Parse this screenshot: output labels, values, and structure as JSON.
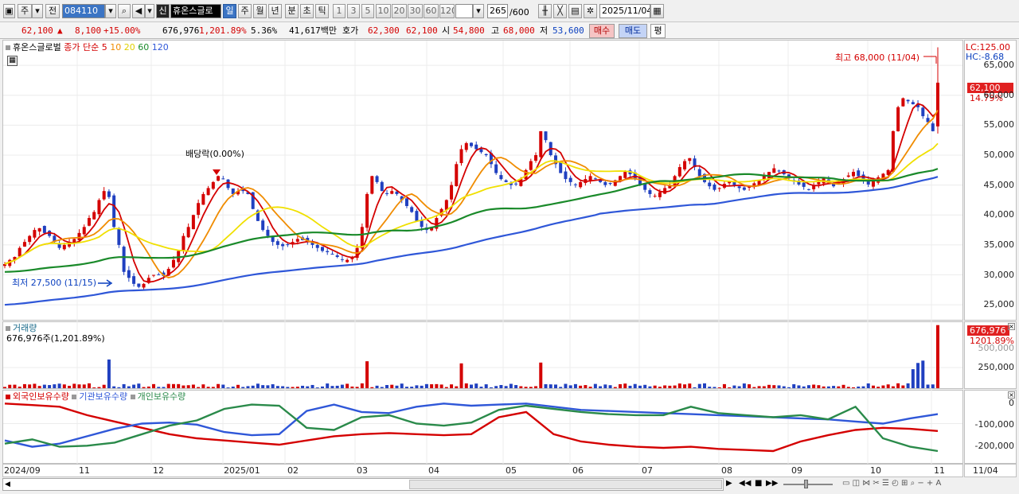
{
  "toolbar": {
    "type_label": "주",
    "prev_label": "전",
    "code": "084110",
    "signal_badge": "신",
    "stock_name": "휴온스글로",
    "periods": [
      "일",
      "주",
      "월",
      "년",
      "분",
      "초",
      "틱"
    ],
    "active_period": "일",
    "minute_nums": [
      "1",
      "3",
      "5",
      "10",
      "20",
      "30",
      "60",
      "120"
    ],
    "count": "265",
    "count_total": "/600",
    "date": "2025/11/04"
  },
  "quote": {
    "price": "62,100",
    "up_arrow": "▲",
    "change": "8,100",
    "change_pct": "+15.00%",
    "volume": "676,976",
    "volume_ratio": "1,201.89%",
    "turnover": "5.36%",
    "amount": "41,617백만",
    "ask_label": "호가",
    "ask": "62,300",
    "bid": "62,100",
    "open_label": "시",
    "open": "54,800",
    "high_label": "고",
    "high": "68,000",
    "low_label": "저",
    "low": "53,600",
    "buy_label": "매수",
    "sell_label": "매도",
    "eval_label": "평"
  },
  "price_panel": {
    "title": "휴온스글로벌",
    "ma_title": "종가 단순",
    "ma_periods": [
      "5",
      "10",
      "20",
      "60",
      "120"
    ],
    "ma_colors": [
      "#d40000",
      "#f08c00",
      "#f0e000",
      "#1a8a2a",
      "#2f57d8"
    ],
    "lc": "LC:125.00",
    "hc": "HC:-8.68",
    "high_note": "최고 68,000 (11/04)",
    "low_note": "최저 27,500 (11/15)",
    "dividend_note": "배당락(0.00%)",
    "last_price": "62,100",
    "last_pct": "14.79%",
    "y_ticks": [
      "65,000",
      "60,000",
      "55,000",
      "50,000",
      "45,000",
      "40,000",
      "35,000",
      "30,000",
      "25,000"
    ]
  },
  "volume_panel": {
    "title": "거래량",
    "summary": "676,976주(1,201.89%)",
    "last": "676,976",
    "last_pct": "1201.89%",
    "y_ticks": [
      "500,000",
      "250,000"
    ]
  },
  "holder_panel": {
    "series": [
      "외국인보유수량",
      "기관보유수량",
      "개인보유수량"
    ],
    "series_colors": [
      "#d40000",
      "#2f57d8",
      "#2a8a4a"
    ],
    "y_ticks": [
      "0",
      "-100,000",
      "-200,000"
    ]
  },
  "x_axis": {
    "labels": [
      "2024/09",
      "11",
      "12",
      "2025/01",
      "02",
      "03",
      "04",
      "05",
      "06",
      "07",
      "08",
      "09",
      "10",
      "11"
    ],
    "current": "11/04"
  },
  "chart_data": {
    "type": "candlestick",
    "ylim": [
      22500,
      69000
    ],
    "closes": [
      31800,
      32500,
      33000,
      34500,
      35500,
      36500,
      37500,
      37800,
      37000,
      36500,
      35500,
      34500,
      35000,
      35500,
      36000,
      37000,
      38000,
      39500,
      40500,
      42500,
      44000,
      43000,
      38000,
      35000,
      30500,
      29500,
      28500,
      28000,
      28500,
      29500,
      30000,
      30000,
      29800,
      31000,
      32500,
      34000,
      36500,
      38000,
      40000,
      42000,
      43500,
      44500,
      45500,
      46500,
      46000,
      44500,
      43500,
      44000,
      44000,
      43500,
      41000,
      39000,
      37500,
      36500,
      35500,
      35000,
      34800,
      35000,
      35500,
      36000,
      35800,
      35500,
      35000,
      34500,
      34000,
      33800,
      33500,
      33000,
      32500,
      32500,
      33000,
      34500,
      38000,
      43500,
      46500,
      45500,
      44000,
      43500,
      44000,
      43500,
      42500,
      41500,
      40500,
      39000,
      38000,
      37500,
      38000,
      39500,
      41000,
      42500,
      45000,
      48500,
      51000,
      52000,
      51500,
      51000,
      50500,
      50000,
      48500,
      47000,
      46000,
      45500,
      45000,
      45200,
      46000,
      47500,
      49000,
      50000,
      54000,
      52500,
      50000,
      48500,
      47000,
      46000,
      45500,
      45000,
      45500,
      46000,
      46500,
      46000,
      45500,
      45000,
      45200,
      45800,
      46500,
      47200,
      46800,
      46000,
      45000,
      44200,
      43500,
      43200,
      43800,
      44500,
      45000,
      46500,
      48000,
      49000,
      49500,
      48000,
      46500,
      45500,
      44800,
      44200,
      44500,
      45200,
      45600,
      45000,
      44500,
      44200,
      44800,
      45300,
      45800,
      46500,
      47200,
      47800,
      47400,
      46800,
      46200,
      45600,
      45100,
      44700,
      44300,
      44900,
      45500,
      46100,
      45400,
      44800,
      45400,
      46000,
      46600,
      47200,
      46500,
      45800,
      45100,
      45700,
      46300,
      46900,
      47500,
      54000,
      58000,
      59500,
      59000,
      58500,
      58000,
      56500,
      55500,
      54000,
      62100
    ],
    "volume_series": [
      {
        "name": "외국인보유수량",
        "values": [
          -5000,
          -12000,
          -20000,
          -60000,
          -90000,
          -120000,
          -150000,
          -170000,
          -180000,
          -190000,
          -200000,
          -180000,
          -160000,
          -150000,
          -145000,
          -150000,
          -155000,
          -150000,
          -70000,
          -45000,
          -150000,
          -185000,
          -200000,
          -210000,
          -215000,
          -210000,
          -220000,
          -225000,
          -230000,
          -185000,
          -155000,
          -130000,
          -120000,
          -125000,
          -135000
        ]
      },
      {
        "name": "기관보유수량",
        "values": [
          -180000,
          -210000,
          -195000,
          -160000,
          -125000,
          -100000,
          -95000,
          -105000,
          -140000,
          -155000,
          -150000,
          -40000,
          -10000,
          -45000,
          -50000,
          -20000,
          -5000,
          -15000,
          -10000,
          -5000,
          -20000,
          -35000,
          -40000,
          -45000,
          -50000,
          -55000,
          -60000,
          -65000,
          -70000,
          -75000,
          -80000,
          -90000,
          -100000,
          -75000,
          -55000
        ]
      },
      {
        "name": "개인보유수량",
        "values": [
          -195000,
          -175000,
          -210000,
          -205000,
          -190000,
          -150000,
          -110000,
          -85000,
          -30000,
          -10000,
          -15000,
          -120000,
          -130000,
          -70000,
          -60000,
          -100000,
          -110000,
          -95000,
          -35000,
          -15000,
          -30000,
          -45000,
          -55000,
          -60000,
          -60000,
          -20000,
          -50000,
          -60000,
          -70000,
          -60000,
          -80000,
          -20000,
          -170000,
          -210000,
          -230000
        ]
      }
    ]
  }
}
